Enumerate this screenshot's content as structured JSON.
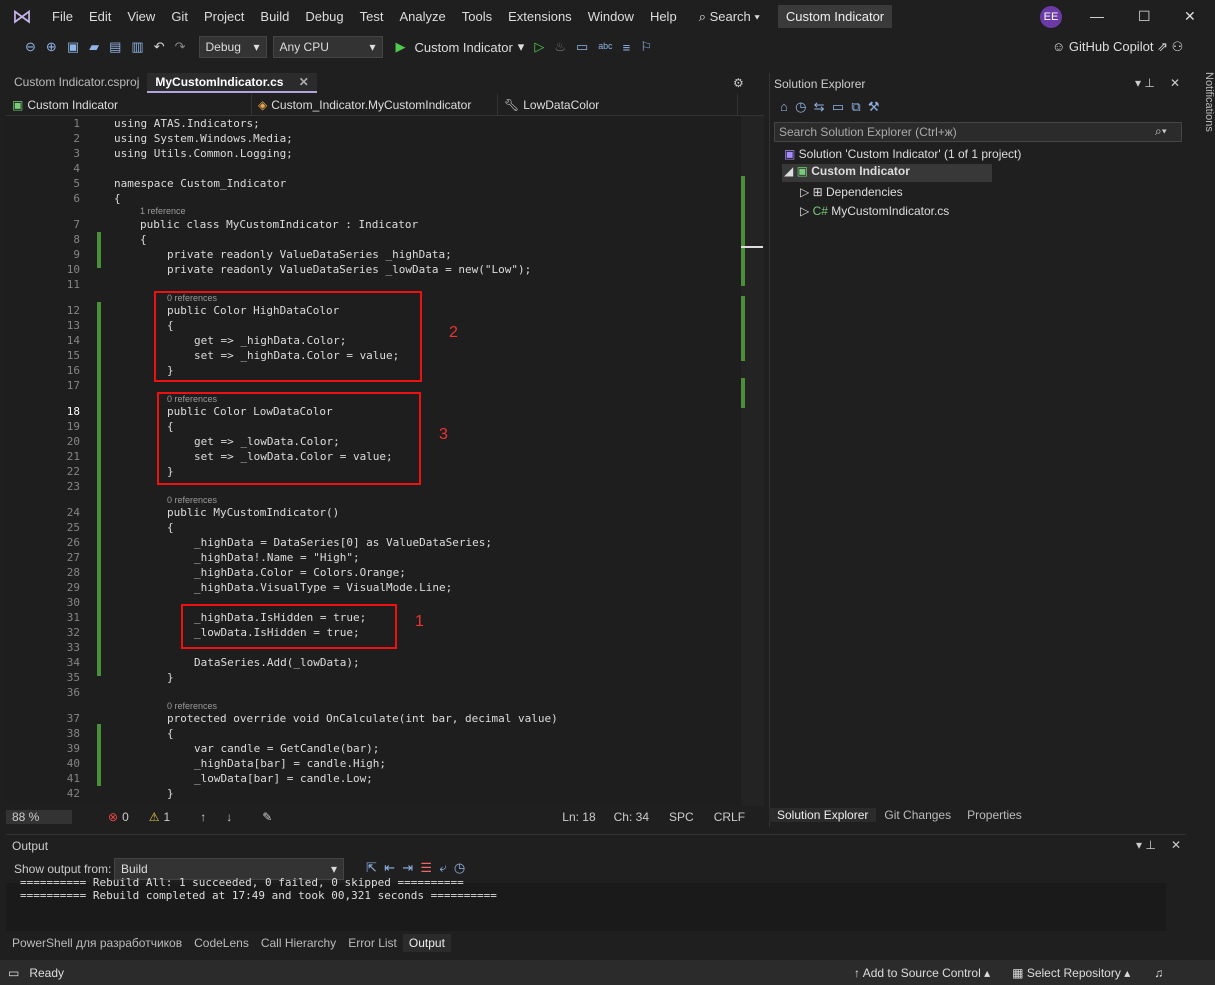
{
  "menu": {
    "items": [
      "File",
      "Edit",
      "View",
      "Git",
      "Project",
      "Build",
      "Debug",
      "Test",
      "Analyze",
      "Tools",
      "Extensions",
      "Window",
      "Help"
    ],
    "search": "Search",
    "title": "Custom Indicator",
    "avatar": "EE"
  },
  "toolbar": {
    "config": "Debug",
    "platform": "Any CPU",
    "run_target": "Custom Indicator",
    "copilot": "GitHub Copilot"
  },
  "tabs": [
    {
      "label": "Custom Indicator.csproj"
    },
    {
      "label": "MyCustomIndicator.cs"
    }
  ],
  "nav": {
    "project": "Custom Indicator",
    "type": "Custom_Indicator.MyCustomIndicator",
    "member": "LowDataColor"
  },
  "code": {
    "l1": "using ATAS.Indicators;",
    "l2": "using System.Windows.Media;",
    "l3": "using Utils.Common.Logging;",
    "l5": "namespace Custom_Indicator",
    "l6": "{",
    "ref7": "1 reference",
    "l7": "public class MyCustomIndicator : Indicator",
    "l8": "{",
    "l9": "private readonly ValueDataSeries _highData;",
    "l10": "private readonly ValueDataSeries _lowData = new(\"Low\");",
    "ref12": "0 references",
    "l12": "public Color HighDataColor",
    "l13": "{",
    "l14": "get => _highData.Color;",
    "l15": "set => _highData.Color = value;",
    "l16": "}",
    "ref18": "0 references",
    "l18": "public Color LowDataColor",
    "l19": "{",
    "l20": "get => _lowData.Color;",
    "l21": "set => _lowData.Color = value;",
    "l22": "}",
    "ref24": "0 references",
    "l24": "public MyCustomIndicator()",
    "l25": "{",
    "l26": "_highData = DataSeries[0] as ValueDataSeries;",
    "l27": "_highData!.Name = \"High\";",
    "l28": "_highData.Color = Colors.Orange;",
    "l29": "_highData.VisualType = VisualMode.Line;",
    "l31": "_highData.IsHidden = true;",
    "l32": "_lowData.IsHidden = true;",
    "l34": "DataSeries.Add(_lowData);",
    "l35": "}",
    "ref37": "0 references",
    "l37": "protected override void OnCalculate(int bar, decimal value)",
    "l38": "{",
    "l39": "var candle = GetCandle(bar);",
    "l40": "_highData[bar] = candle.High;",
    "l41": "_lowData[bar] = candle.Low;",
    "l42": "}"
  },
  "annotations": {
    "a1": "1",
    "a2": "2",
    "a3": "3"
  },
  "editor_status": {
    "zoom": "88 %",
    "errors": "0",
    "warnings": "1",
    "ln": "Ln: 18",
    "ch": "Ch: 34",
    "spc": "SPC",
    "crlf": "CRLF"
  },
  "solution": {
    "title": "Solution Explorer",
    "search": "Search Solution Explorer (Ctrl+ж)",
    "root": "Solution 'Custom Indicator' (1 of 1 project)",
    "project": "Custom Indicator",
    "deps": "Dependencies",
    "file": "MyCustomIndicator.cs"
  },
  "right_tabs": [
    "Solution Explorer",
    "Git Changes",
    "Properties"
  ],
  "output": {
    "title": "Output",
    "show_from": "Show output from:",
    "source": "Build",
    "line1": "========== Rebuild All: 1 succeeded, 0 failed, 0 skipped ==========",
    "line2": "========== Rebuild completed at 17:49 and took 00,321 seconds =========="
  },
  "output_tabs": [
    "PowerShell для разработчиков",
    "CodeLens",
    "Call Hierarchy",
    "Error List",
    "Output"
  ],
  "status": {
    "ready": "Ready",
    "source_control": "Add to Source Control",
    "repo": "Select Repository"
  },
  "notifications": "Notifications"
}
